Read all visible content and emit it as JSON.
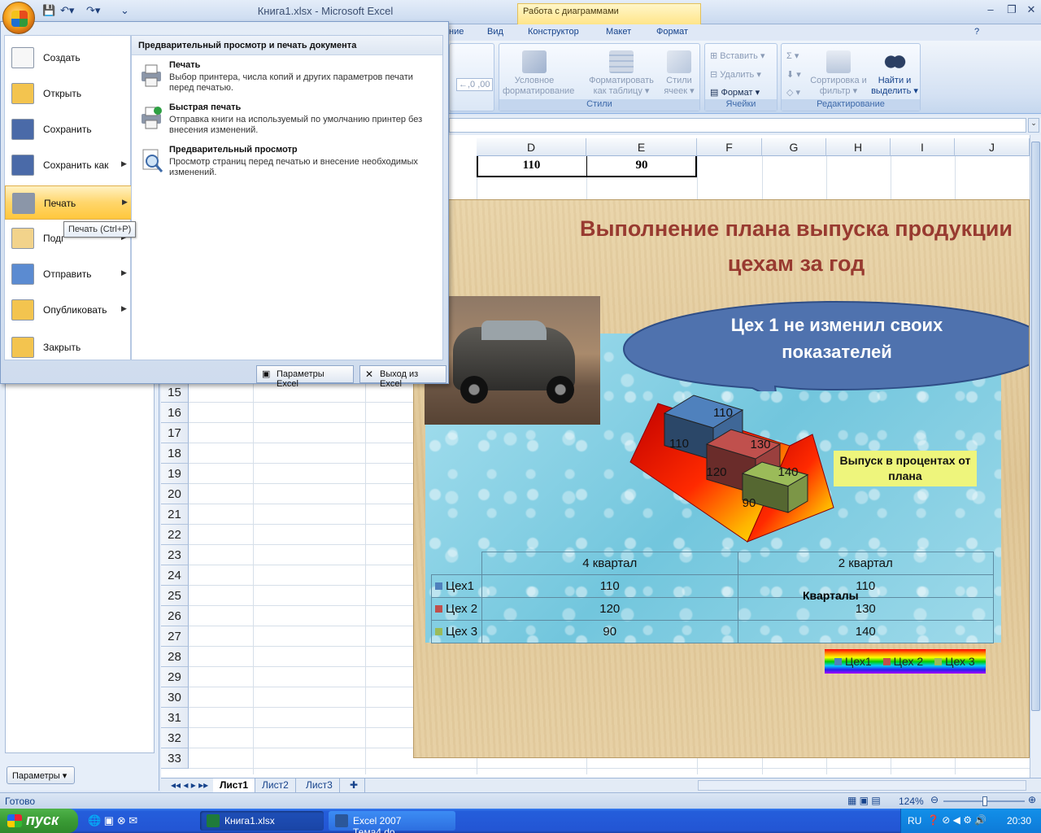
{
  "window": {
    "title": "Книга1.xlsx - Microsoft Excel",
    "context_tab": "Работа с диаграммами"
  },
  "ribbon": {
    "tabs": [
      "ние",
      "Вид",
      "Конструктор",
      "Макет",
      "Формат"
    ],
    "styles": {
      "cond_format": "Условное форматирование ▾",
      "format_table": "Форматировать как таблицу ▾",
      "cell_styles": "Стили ячеек ▾",
      "group_label": "Стили"
    },
    "cells": {
      "insert": "Вставить ▾",
      "delete": "Удалить ▾",
      "format": "Формат ▾",
      "group_label": "Ячейки"
    },
    "editing": {
      "sort": "Сортировка и фильтр ▾",
      "find": "Найти и выделить ▾",
      "group_label": "Редактирование"
    }
  },
  "office_menu": {
    "items": [
      {
        "label": "Создать",
        "has_submenu": false
      },
      {
        "label": "Открыть",
        "has_submenu": false
      },
      {
        "label": "Сохранить",
        "has_submenu": false
      },
      {
        "label": "Сохранить как",
        "has_submenu": true
      },
      {
        "label": "Печать",
        "has_submenu": true,
        "active": true
      },
      {
        "label": "Подг",
        "has_submenu": true
      },
      {
        "label": "Отправить",
        "has_submenu": true
      },
      {
        "label": "Опубликовать",
        "has_submenu": true
      },
      {
        "label": "Закрыть",
        "has_submenu": false
      }
    ],
    "submenu_header": "Предварительный просмотр и печать документа",
    "submenu": [
      {
        "title": "Печать",
        "desc": "Выбор принтера, числа копий и других параметров печати перед печатью."
      },
      {
        "title": "Быстрая печать",
        "desc": "Отправка книги на используемый по умолчанию принтер без внесения изменений."
      },
      {
        "title": "Предварительный просмотр",
        "desc": "Просмотр страниц перед печатью и внесение необходимых изменений."
      }
    ],
    "tooltip": "Печать (Ctrl+P)",
    "options_button": "Параметры Excel",
    "exit_button": "Выход из Excel"
  },
  "taskpane": {
    "params_button": "Параметры ▾"
  },
  "grid": {
    "columns": [
      "D",
      "E",
      "F",
      "G",
      "H",
      "I",
      "J"
    ],
    "rows": [
      "15",
      "16",
      "17",
      "18",
      "19",
      "20",
      "21",
      "22",
      "23",
      "24",
      "25",
      "26",
      "27",
      "28",
      "29",
      "30",
      "31",
      "32",
      "33"
    ],
    "cell_d": "110",
    "cell_e": "90"
  },
  "chart": {
    "title_line1": "Выполнение плана выпуска продукции",
    "title_line2": "цехам за год",
    "callout_line1": "Цех 1 не изменил своих",
    "callout_line2": "показателей",
    "note": "Выпуск в процентах от плана",
    "axis_label": "Кварталы",
    "legend": [
      "Цех1",
      "Цех 2",
      "Цех 3"
    ]
  },
  "chart_data": {
    "type": "bar",
    "categories": [
      "4 квартал",
      "2 квартал"
    ],
    "series": [
      {
        "name": "Цех1",
        "values": [
          110,
          110
        ],
        "color": "#4f81bd"
      },
      {
        "name": "Цех 2",
        "values": [
          120,
          130
        ],
        "color": "#c0504d"
      },
      {
        "name": "Цех 3",
        "values": [
          90,
          140
        ],
        "color": "#9bbb59"
      }
    ],
    "title": "Выполнение плана выпуска продукции цехам за год",
    "xlabel": "Кварталы",
    "legend_position": "bottom-right",
    "data_table": true
  },
  "sheets": {
    "tabs": [
      "Лист1",
      "Лист2",
      "Лист3"
    ],
    "active": "Лист1"
  },
  "status": {
    "ready": "Готово",
    "zoom": "124%"
  },
  "taskbar": {
    "start": "пуск",
    "tasks": [
      "Книга1.xlsx",
      "Excel 2007 Тема4.do..."
    ],
    "lang": "RU",
    "clock": "20:30"
  },
  "colors": {
    "title": "#983a30",
    "callout": "#4f72ae",
    "series1": "#4f81bd",
    "series2": "#c0504d",
    "series3": "#9bbb59"
  }
}
